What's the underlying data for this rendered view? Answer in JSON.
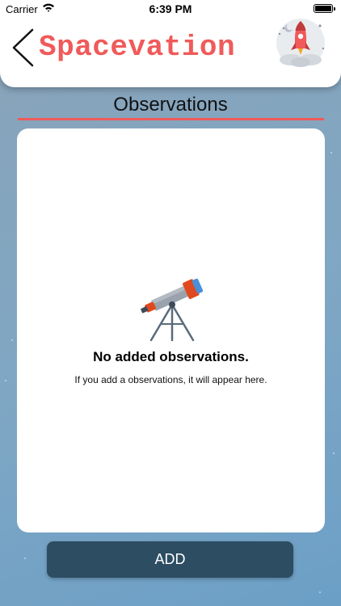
{
  "status_bar": {
    "carrier": "Carrier",
    "time": "6:39 PM",
    "battery_level": 1.0,
    "wifi_icon": "wifi-icon"
  },
  "header": {
    "title": "Spacevation",
    "back_icon": "chevron-left-icon",
    "logo_icon": "rocket-logo-icon",
    "title_color": "#f05a5a"
  },
  "section": {
    "title": "Observations",
    "underline_color": "#f05a5a"
  },
  "empty_state": {
    "icon": "telescope-icon",
    "title": "No added observations.",
    "message": "If you add a observations, it will appear here."
  },
  "actions": {
    "add_label": "ADD",
    "add_color": "#2d4d62"
  }
}
